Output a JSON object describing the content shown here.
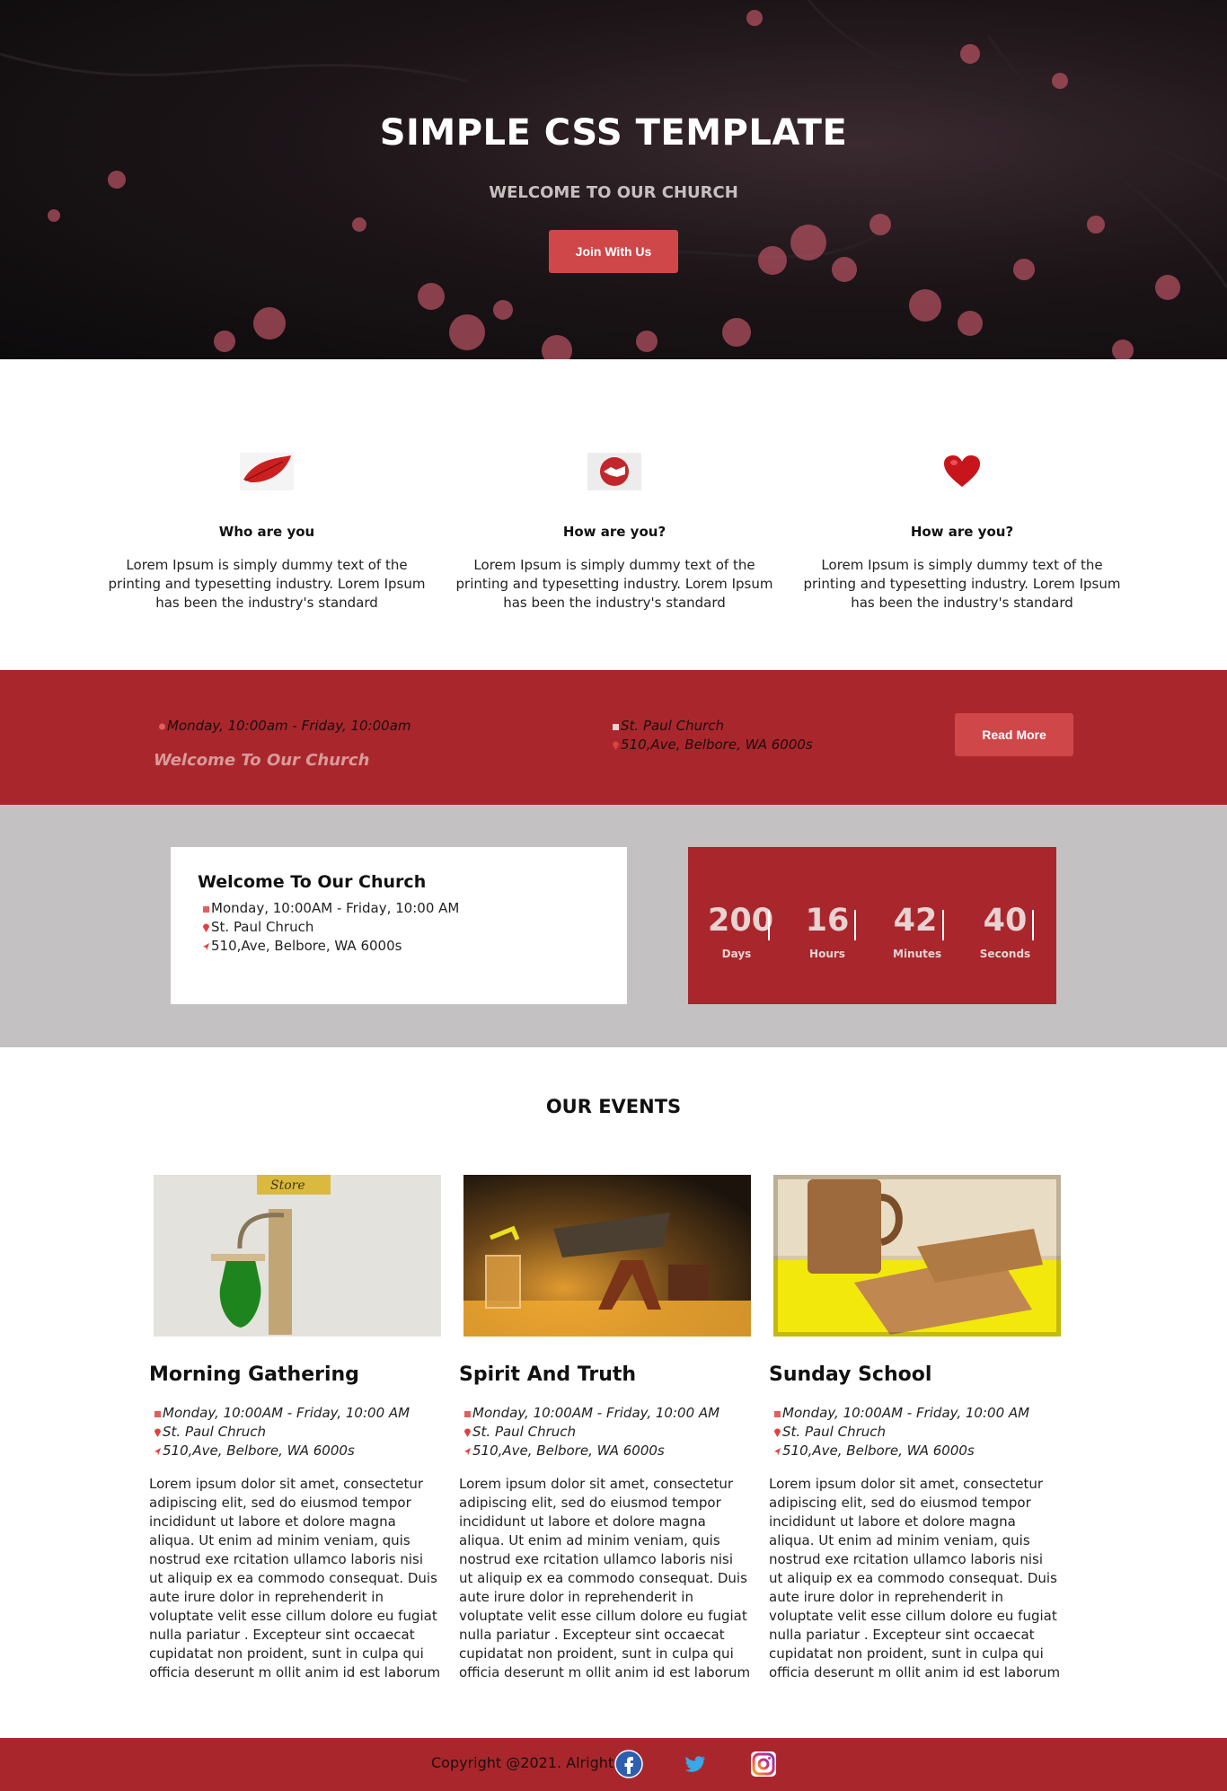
{
  "hero": {
    "title": "SIMPLE CSS TEMPLATE",
    "subtitle": "WELCOME TO OUR CHURCH",
    "button": "Join With Us"
  },
  "features": [
    {
      "icon": "leaf-icon",
      "title": "Who are you",
      "text": "Lorem Ipsum is simply dummy text of the printing and typesetting industry. Lorem Ipsum has been the industry's standard"
    },
    {
      "icon": "handshake-icon",
      "title": "How are you?",
      "text": "Lorem Ipsum is simply dummy text of the printing and typesetting industry. Lorem Ipsum has been the industry's standard"
    },
    {
      "icon": "heart-icon",
      "title": "How are you?",
      "text": "Lorem Ipsum is simply dummy text of the printing and typesetting industry. Lorem Ipsum has been the industry's standard"
    }
  ],
  "infobar": {
    "schedule": "Monday, 10:00am - Friday, 10:00am",
    "welcome": "Welcome To Our Church",
    "church": "St. Paul Church",
    "address": "510,Ave, Belbore, WA 6000s",
    "button": "Read More"
  },
  "welcome_card": {
    "title": "Welcome To Our Church",
    "schedule": "Monday, 10:00AM - Friday, 10:00 AM",
    "church": "St. Paul Chruch",
    "address": "510,Ave, Belbore, WA 6000s"
  },
  "countdown": {
    "days": "200",
    "days_label": "Days",
    "hours": "16",
    "hours_label": "Hours",
    "minutes": "42",
    "minutes_label": "Minutes",
    "seconds": "40",
    "seconds_label": "Seconds"
  },
  "events": {
    "title": "OUR EVENTS",
    "items": [
      {
        "title": "Morning Gathering",
        "schedule": "Monday, 10:00AM - Friday, 10:00 AM",
        "church": "St. Paul Chruch",
        "address": "510,Ave, Belbore, WA 6000s",
        "desc": "Lorem ipsum dolor sit amet, consectetur adipiscing elit, sed do eiusmod tempor incididunt ut labore et dolore magna aliqua. Ut enim ad minim veniam, quis nostrud exe rcitation ullamco laboris nisi ut aliquip ex ea commodo consequat. Duis aute irure dolor in reprehenderit in voluptate velit esse cillum dolore eu fugiat nulla pariatur . Excepteur sint occaecat cupidatat non proident, sunt in culpa qui officia deserunt m ollit anim id est laborum",
        "image_sign": "Store"
      },
      {
        "title": "Spirit And Truth",
        "schedule": "Monday, 10:00AM - Friday, 10:00 AM",
        "church": "St. Paul Chruch",
        "address": "510,Ave, Belbore, WA 6000s",
        "desc": "Lorem ipsum dolor sit amet, consectetur adipiscing elit, sed do eiusmod tempor incididunt ut labore et dolore magna aliqua. Ut enim ad minim veniam, quis nostrud exe rcitation ullamco laboris nisi ut aliquip ex ea commodo consequat. Duis aute irure dolor in reprehenderit in voluptate velit esse cillum dolore eu fugiat nulla pariatur . Excepteur sint occaecat cupidatat non proident, sunt in culpa qui officia deserunt m ollit anim id est laborum"
      },
      {
        "title": "Sunday School",
        "schedule": "Monday, 10:00AM - Friday, 10:00 AM",
        "church": "St. Paul Chruch",
        "address": "510,Ave, Belbore, WA 6000s",
        "desc": "Lorem ipsum dolor sit amet, consectetur adipiscing elit, sed do eiusmod tempor incididunt ut labore et dolore magna aliqua. Ut enim ad minim veniam, quis nostrud exe rcitation ullamco laboris nisi ut aliquip ex ea commodo consequat. Duis aute irure dolor in reprehenderit in voluptate velit esse cillum dolore eu fugiat nulla pariatur . Excepteur sint occaecat cupidatat non proident, sunt in culpa qui officia deserunt m ollit anim id est laborum"
      }
    ]
  },
  "footer": {
    "copyright": "Copyright @2021. Alright",
    "social": [
      "facebook-icon",
      "twitter-icon",
      "instagram-icon"
    ]
  },
  "colors": {
    "brand_red": "#a9272c",
    "button_red": "#cf4749",
    "gray_band": "#c4c1c2"
  }
}
